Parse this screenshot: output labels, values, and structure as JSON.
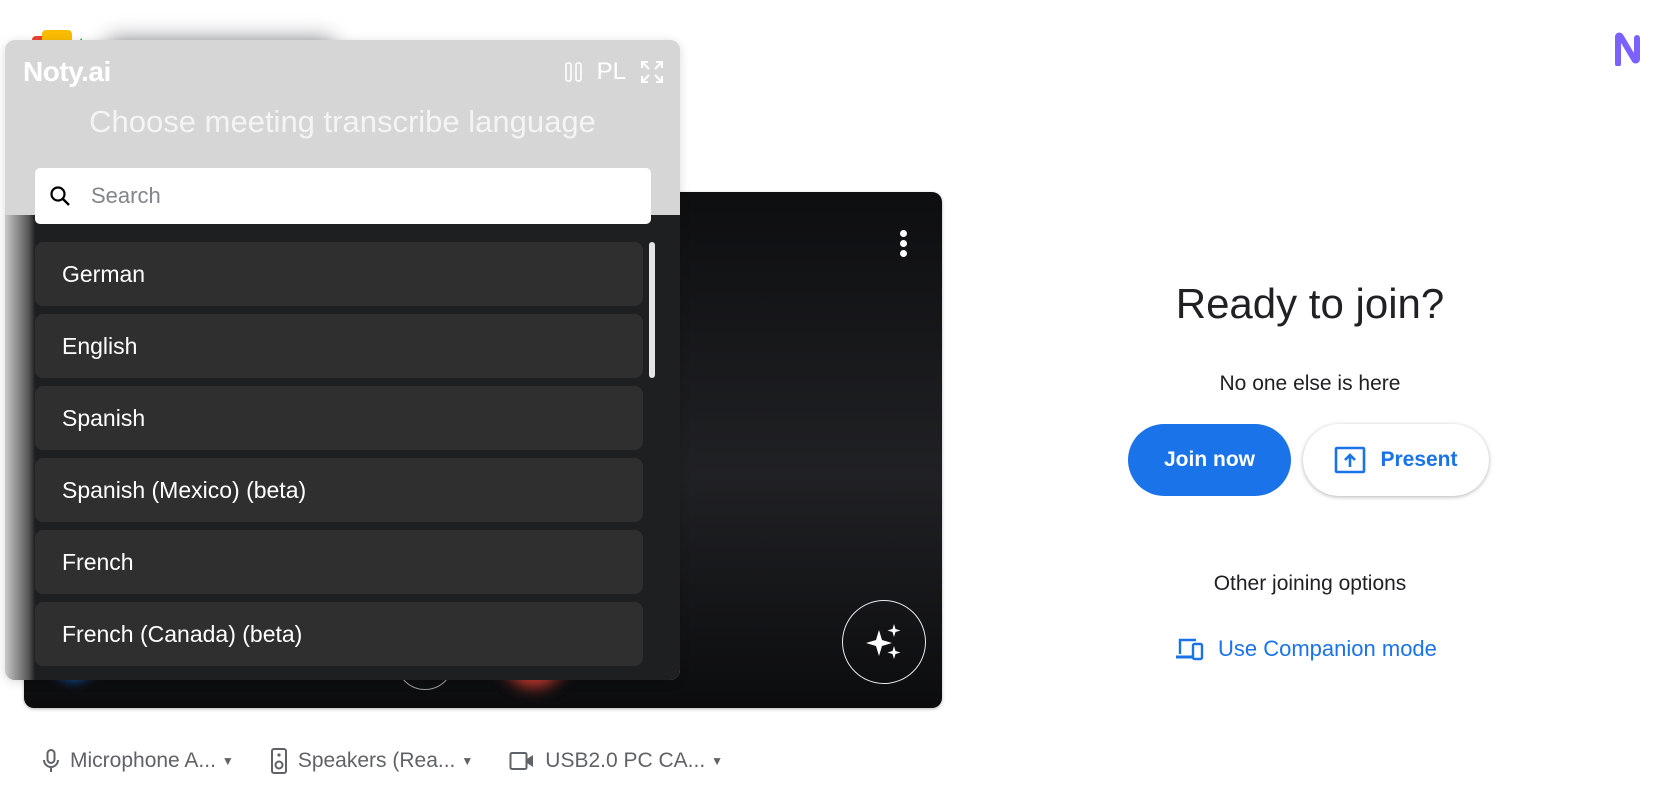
{
  "noty": {
    "logo": "Noty.ai",
    "language_code": "PL",
    "heading": "Choose meeting transcribe language",
    "search": {
      "placeholder": "Search",
      "value": ""
    },
    "languages": [
      "German",
      "English",
      "Spanish",
      "Spanish (Mexico) (beta)",
      "French",
      "French (Canada) (beta)"
    ],
    "icons": {
      "pause": "pause-icon",
      "expand": "expand-icon",
      "search": "search-icon"
    }
  },
  "meet": {
    "ready_title": "Ready to join?",
    "status": "No one else is here",
    "join_label": "Join now",
    "present_label": "Present",
    "other_options": "Other joining options",
    "companion_label": "Use Companion mode",
    "devices": {
      "microphone": "Microphone A...",
      "speakers": "Speakers (Rea...",
      "camera": "USB2.0 PC CA..."
    }
  },
  "colors": {
    "accent": "#1a73e8",
    "noty_brand": "#7b61ff",
    "panel_bg": "#d6d6d6",
    "list_item_bg": "#2f2f2f"
  }
}
